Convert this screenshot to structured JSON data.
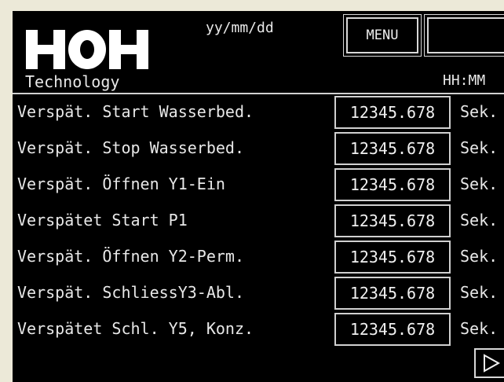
{
  "header": {
    "brand_sub": "Technology",
    "date_format": "yy/mm/dd",
    "time_format": "HH:MM",
    "menu_label": "MENU"
  },
  "rows": [
    {
      "label": "Verspät. Start Wasserbed.",
      "value": "12345.678",
      "unit": "Sek."
    },
    {
      "label": "Verspät. Stop Wasserbed.",
      "value": "12345.678",
      "unit": "Sek."
    },
    {
      "label": "Verspät. Öffnen Y1-Ein",
      "value": "12345.678",
      "unit": "Sek."
    },
    {
      "label": "Verspätet Start P1",
      "value": "12345.678",
      "unit": "Sek."
    },
    {
      "label": "Verspät. Öffnen Y2-Perm.",
      "value": "12345.678",
      "unit": "Sek."
    },
    {
      "label": "Verspät. SchliessY3-Abl.",
      "value": "12345.678",
      "unit": "Sek."
    },
    {
      "label": "Verspätet Schl. Y5, Konz.",
      "value": "12345.678",
      "unit": "Sek."
    }
  ],
  "icons": {
    "next": "play-right-icon"
  },
  "logo_text": "HOH"
}
